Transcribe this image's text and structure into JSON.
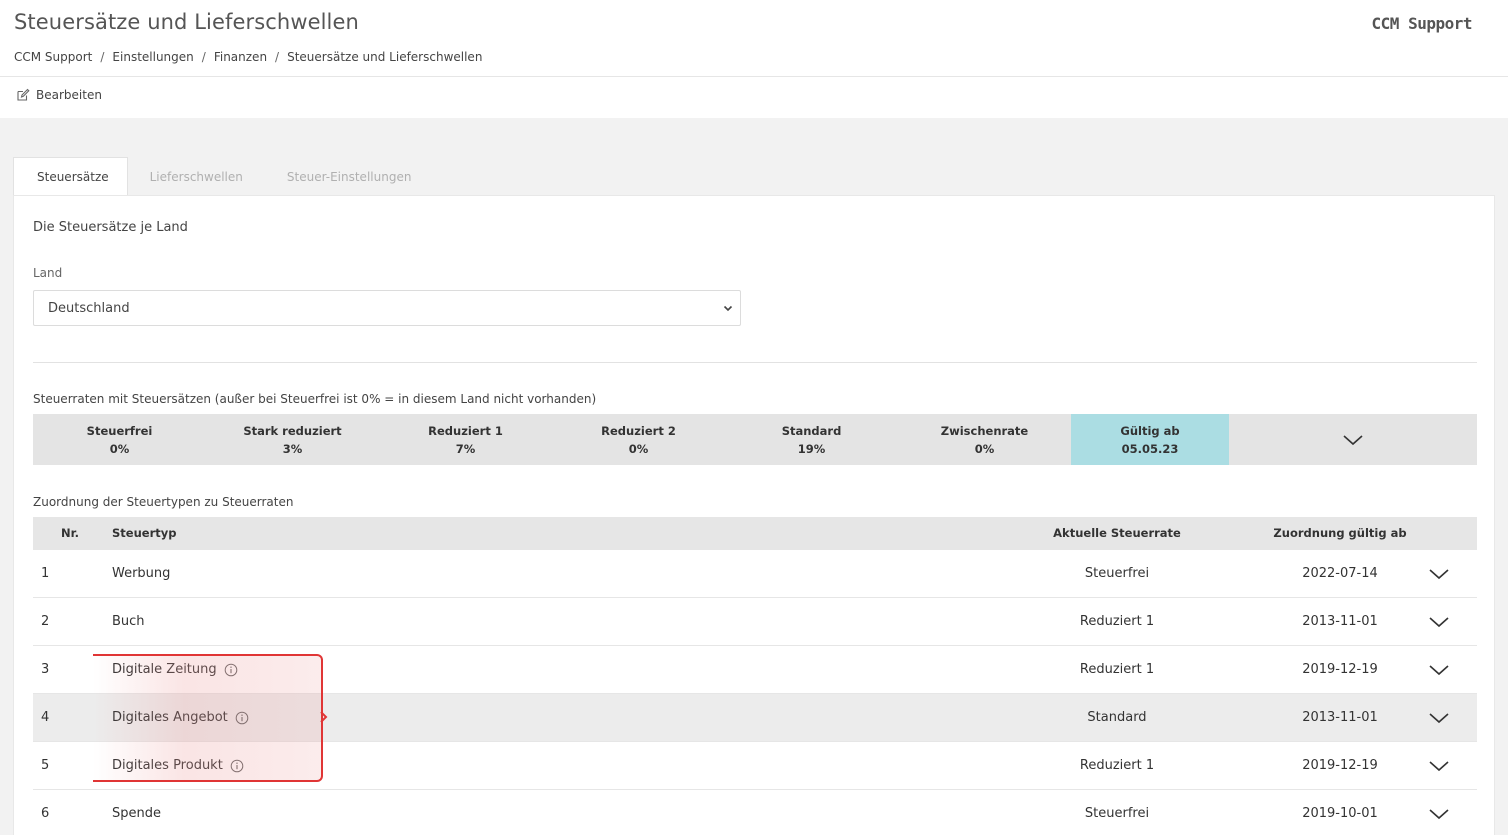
{
  "header": {
    "title": "Steuersätze und Lieferschwellen",
    "brand": "CCM Support",
    "breadcrumb": [
      "CCM Support",
      "Einstellungen",
      "Finanzen",
      "Steuersätze und Lieferschwellen"
    ],
    "edit_label": "Bearbeiten",
    "edit_icon": "edit-icon"
  },
  "tabs": [
    {
      "label": "Steuersätze",
      "active": true
    },
    {
      "label": "Lieferschwellen",
      "active": false
    },
    {
      "label": "Steuer-Einstellungen",
      "active": false
    }
  ],
  "panel": {
    "section_title": "Die Steuersätze je Land",
    "land_label": "Land",
    "land_value": "Deutschland"
  },
  "rates": {
    "caption": "Steuerraten mit Steuersätzen (außer bei Steuerfrei ist 0% = in diesem Land nicht vorhanden)",
    "items": [
      {
        "name": "Steuerfrei",
        "value": "0%"
      },
      {
        "name": "Stark reduziert",
        "value": "3%"
      },
      {
        "name": "Reduziert 1",
        "value": "7%"
      },
      {
        "name": "Reduziert 2",
        "value": "0%"
      },
      {
        "name": "Standard",
        "value": "19%"
      },
      {
        "name": "Zwischenrate",
        "value": "0%"
      }
    ],
    "valid": {
      "name": "Gültig ab",
      "value": "05.05.23"
    },
    "valid_color": "#abdde3"
  },
  "assignment": {
    "caption": "Zuordnung der Steuertypen zu Steuerraten",
    "headers": {
      "nr": "Nr.",
      "typ": "Steuertyp",
      "rate": "Aktuelle Steuerrate",
      "date": "Zuordnung gültig ab"
    },
    "rows": [
      {
        "nr": "1",
        "typ": "Werbung",
        "info": false,
        "rate": "Steuerfrei",
        "date": "2022-07-14"
      },
      {
        "nr": "2",
        "typ": "Buch",
        "info": false,
        "rate": "Reduziert 1",
        "date": "2013-11-01"
      },
      {
        "nr": "3",
        "typ": "Digitale Zeitung",
        "info": true,
        "rate": "Reduziert 1",
        "date": "2019-12-19"
      },
      {
        "nr": "4",
        "typ": "Digitales Angebot",
        "info": true,
        "rate": "Standard",
        "date": "2013-11-01"
      },
      {
        "nr": "5",
        "typ": "Digitales Produkt",
        "info": true,
        "rate": "Reduziert 1",
        "date": "2019-12-19"
      },
      {
        "nr": "6",
        "typ": "Spende",
        "info": false,
        "rate": "Steuerfrei",
        "date": "2019-10-01"
      }
    ]
  },
  "colors": {
    "highlight_annotation": "#e03535"
  }
}
